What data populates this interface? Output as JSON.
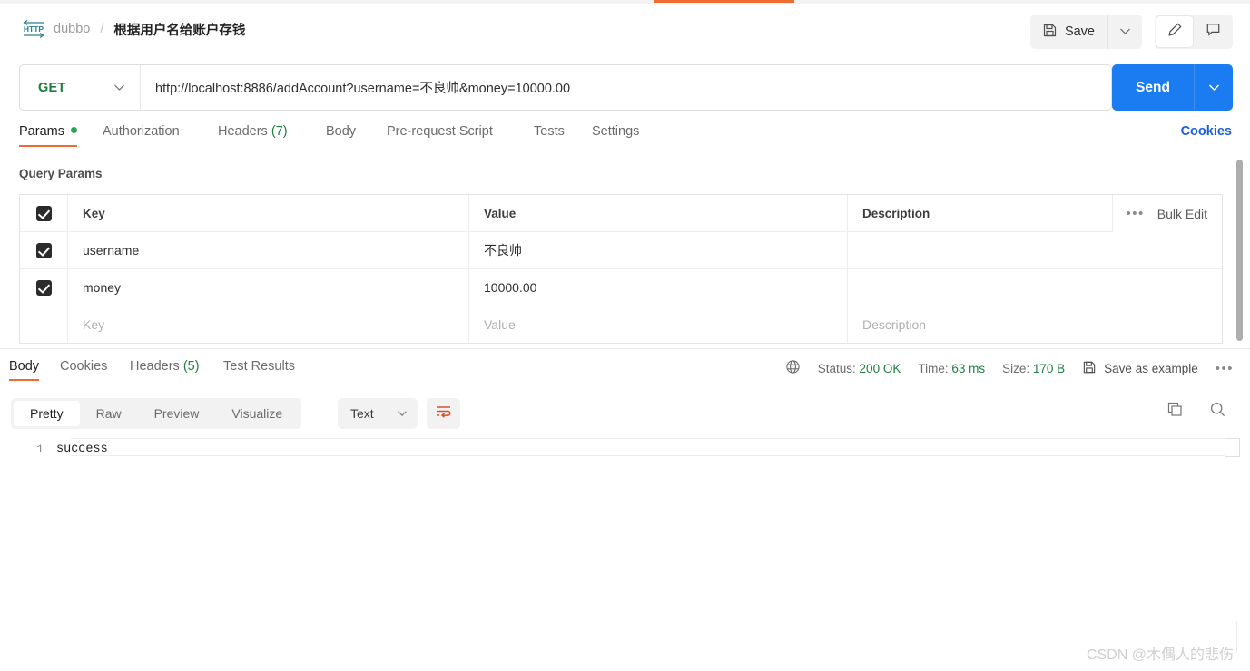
{
  "header": {
    "collection": "dubbo",
    "separator": "/",
    "request_title": "根据用户名给账户存钱",
    "save_label": "Save"
  },
  "request": {
    "method": "GET",
    "url": "http://localhost:8886/addAccount?username=不良帅&money=10000.00",
    "send_label": "Send",
    "method_color": "#1d7d3f",
    "send_color": "#1a7cf0"
  },
  "request_tabs": [
    {
      "label": "Params",
      "badge": "",
      "dot": true,
      "active": true
    },
    {
      "label": "Authorization",
      "badge": "",
      "dot": false,
      "active": false
    },
    {
      "label": "Headers",
      "badge": "(7)",
      "dot": false,
      "active": false
    },
    {
      "label": "Body",
      "badge": "",
      "dot": false,
      "active": false
    },
    {
      "label": "Pre-request Script",
      "badge": "",
      "dot": false,
      "active": false
    },
    {
      "label": "Tests",
      "badge": "",
      "dot": false,
      "active": false
    },
    {
      "label": "Settings",
      "badge": "",
      "dot": false,
      "active": false
    }
  ],
  "cookies_link": "Cookies",
  "params": {
    "section_title": "Query Params",
    "columns": {
      "key": "Key",
      "value": "Value",
      "description": "Description"
    },
    "bulk_edit": "Bulk Edit",
    "rows": [
      {
        "checked": true,
        "key": "username",
        "value": "不良帅",
        "description": ""
      },
      {
        "checked": true,
        "key": "money",
        "value": "10000.00",
        "description": ""
      }
    ],
    "placeholder_row": {
      "key": "Key",
      "value": "Value",
      "description": "Description"
    }
  },
  "response_tabs": [
    {
      "label": "Body",
      "badge": "",
      "active": true
    },
    {
      "label": "Cookies",
      "badge": "",
      "active": false
    },
    {
      "label": "Headers",
      "badge": "(5)",
      "active": false
    },
    {
      "label": "Test Results",
      "badge": "",
      "active": false
    }
  ],
  "response_status": {
    "status_label": "Status:",
    "status_value": "200 OK",
    "time_label": "Time:",
    "time_value": "63 ms",
    "size_label": "Size:",
    "size_value": "170 B",
    "save_as_example": "Save as example",
    "value_color": "#1d7d3f"
  },
  "view_modes": [
    {
      "label": "Pretty",
      "active": true
    },
    {
      "label": "Raw",
      "active": false
    },
    {
      "label": "Preview",
      "active": false
    },
    {
      "label": "Visualize",
      "active": false
    }
  ],
  "format": {
    "selected": "Text"
  },
  "response_body": {
    "line_number": "1",
    "content": "success"
  },
  "watermark": "CSDN @木偶人的悲伤"
}
